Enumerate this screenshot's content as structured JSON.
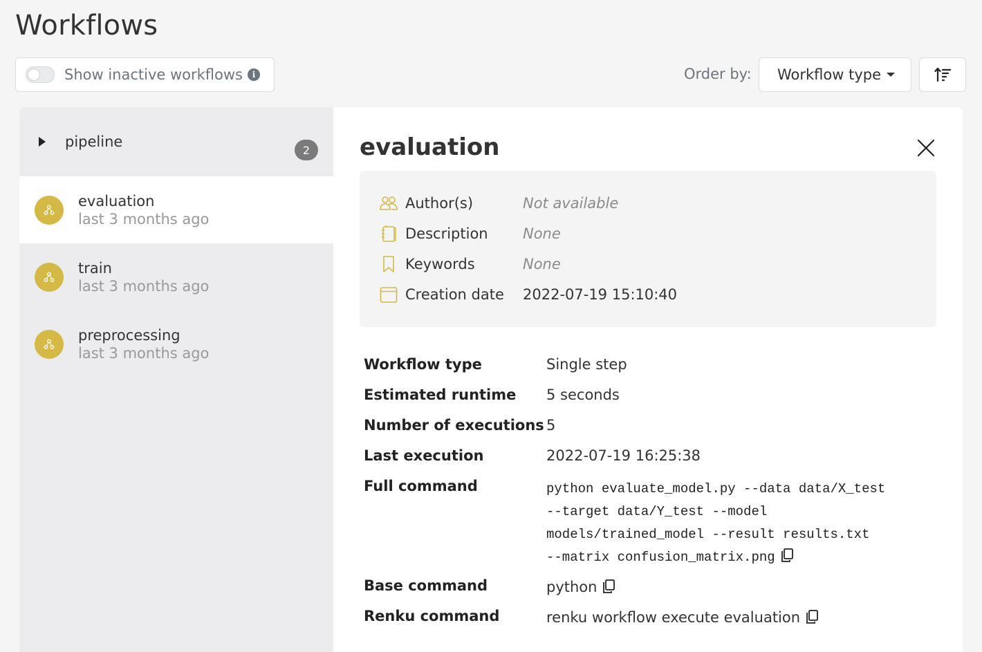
{
  "page": {
    "title": "Workflows"
  },
  "toolbar": {
    "toggle_label": "Show inactive workflows",
    "order_label": "Order by:",
    "order_value": "Workflow type"
  },
  "sidebar": {
    "group": {
      "name": "pipeline",
      "count": "2"
    },
    "items": [
      {
        "name": "evaluation",
        "date": "last 3 months ago",
        "active": true
      },
      {
        "name": "train",
        "date": "last 3 months ago",
        "active": false
      },
      {
        "name": "preprocessing",
        "date": "last 3 months ago",
        "active": false
      }
    ]
  },
  "detail": {
    "title": "evaluation",
    "meta": {
      "author_label": "Author(s)",
      "author_value": "Not available",
      "description_label": "Description",
      "description_value": "None",
      "keywords_label": "Keywords",
      "keywords_value": "None",
      "creation_label": "Creation date",
      "creation_value": "2022-07-19 15:10:40"
    },
    "info": {
      "type_label": "Workflow type",
      "type_value": "Single step",
      "runtime_label": "Estimated runtime",
      "runtime_value": "5 seconds",
      "executions_label": "Number of executions",
      "executions_value": "5",
      "last_label": "Last execution",
      "last_value": "2022-07-19 16:25:38",
      "full_label": "Full command",
      "full_lines": [
        "python evaluate_model.py --data data/X_test",
        "--target data/Y_test --model",
        "models/trained_model --result results.txt",
        "--matrix confusion_matrix.png"
      ],
      "base_label": "Base command",
      "base_value": "python",
      "renku_label": "Renku command",
      "renku_value": "renku workflow execute evaluation"
    }
  },
  "colors": {
    "workflow_icon": "#d4b944",
    "meta_icon": "#d4b944",
    "badge": "#7a7a7a"
  }
}
